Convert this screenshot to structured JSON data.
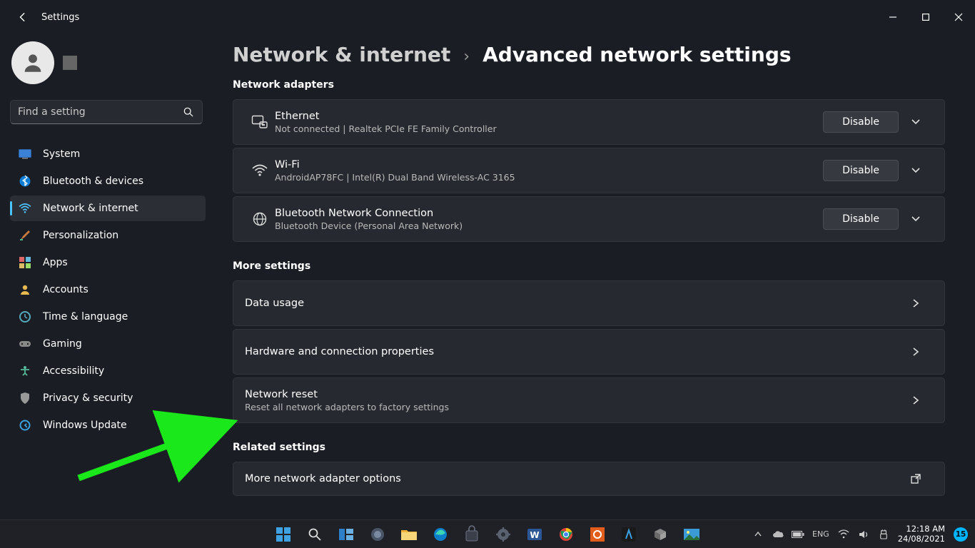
{
  "window": {
    "title": "Settings"
  },
  "search": {
    "placeholder": "Find a setting"
  },
  "nav": {
    "system": "System",
    "bluetooth": "Bluetooth & devices",
    "network": "Network & internet",
    "personalization": "Personalization",
    "apps": "Apps",
    "accounts": "Accounts",
    "time": "Time & language",
    "gaming": "Gaming",
    "accessibility": "Accessibility",
    "privacy": "Privacy & security",
    "update": "Windows Update"
  },
  "breadcrumb": {
    "parent": "Network & internet",
    "current": "Advanced network settings"
  },
  "sections": {
    "adapters_h": "Network adapters",
    "more_h": "More settings",
    "related_h": "Related settings"
  },
  "adapters": {
    "ethernet": {
      "title": "Ethernet",
      "sub": "Not connected | Realtek PCIe FE Family Controller",
      "btn": "Disable"
    },
    "wifi": {
      "title": "Wi-Fi",
      "sub": "AndroidAP78FC | Intel(R) Dual Band Wireless-AC 3165",
      "btn": "Disable"
    },
    "bt": {
      "title": "Bluetooth Network Connection",
      "sub": "Bluetooth Device (Personal Area Network)",
      "btn": "Disable"
    }
  },
  "more": {
    "data": {
      "title": "Data usage"
    },
    "hw": {
      "title": "Hardware and connection properties"
    },
    "reset": {
      "title": "Network reset",
      "sub": "Reset all network adapters to factory settings"
    }
  },
  "related": {
    "more_adapter": {
      "title": "More network adapter options"
    }
  },
  "tray": {
    "time": "12:18 AM",
    "date": "24/08/2021",
    "notif": "15"
  }
}
